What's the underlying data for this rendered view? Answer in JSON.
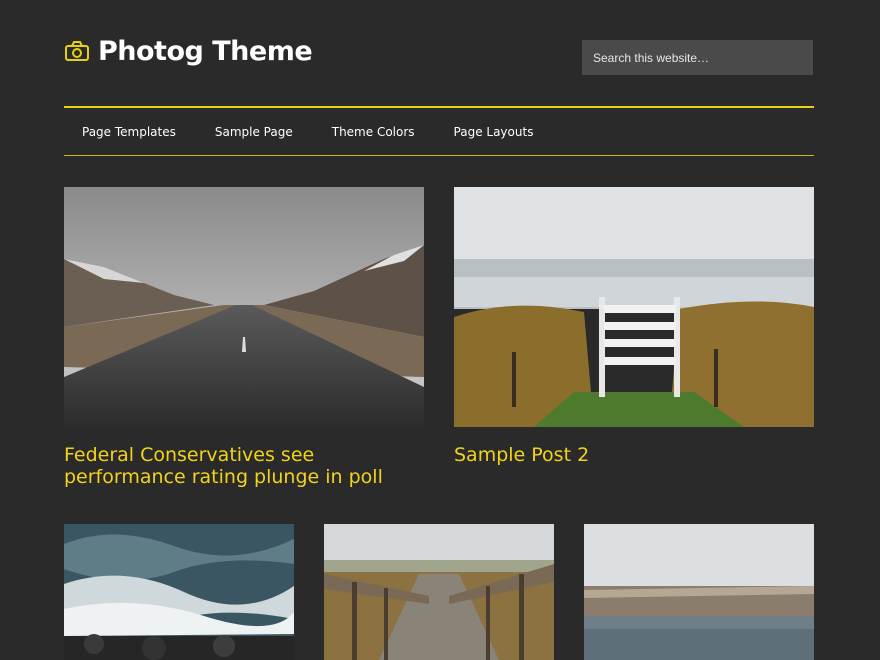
{
  "site": {
    "title": "Photog Theme",
    "logo_icon": "camera-icon",
    "accent_color": "#e6d20f",
    "title_color": "#f2d31c",
    "background": "#2a2a2a"
  },
  "search": {
    "placeholder": "Search this website…"
  },
  "nav": {
    "items": [
      {
        "label": "Page Templates"
      },
      {
        "label": "Sample Page"
      },
      {
        "label": "Theme Colors"
      },
      {
        "label": "Page Layouts"
      }
    ]
  },
  "featured": [
    {
      "title": "Federal Conservatives see performance rating plunge in poll",
      "image": "road-landscape-image"
    },
    {
      "title": "Sample Post 2",
      "image": "beach-stairs-image"
    }
  ],
  "grid": [
    {
      "image": "ocean-waves-image"
    },
    {
      "image": "boardwalk-bridge-image"
    },
    {
      "image": "breakwater-sea-image"
    }
  ]
}
